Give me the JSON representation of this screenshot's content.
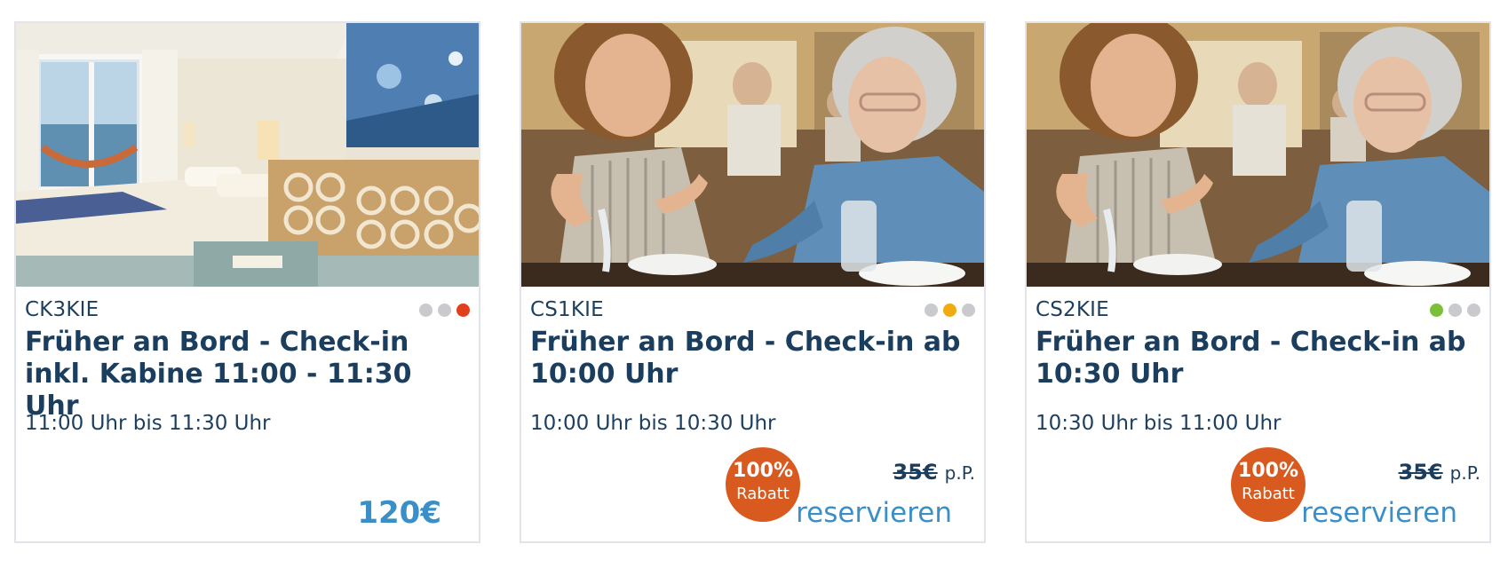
{
  "cards": [
    {
      "photo": "cabin-photo",
      "code": "CK3KIE",
      "status_dots": [
        "#c9cacd",
        "#c9cacd",
        "#e0401c"
      ],
      "title": "Früher an Bord - Check-in inkl. Kabine 11:00 - 11:30 Uhr",
      "time": "11:00 Uhr bis 11:30 Uhr",
      "price": "120€"
    },
    {
      "photo": "restaurant-photo",
      "code": "CS1KIE",
      "status_dots": [
        "#c9cacd",
        "#f0aa12",
        "#c9cacd"
      ],
      "title": "Früher an Bord - Check-in ab 10:00 Uhr",
      "time": "10:00 Uhr bis 10:30 Uhr",
      "badge_percent": "100%",
      "badge_text": "Rabatt",
      "old_price": "35€",
      "per_person": "p.P.",
      "action": "reservieren"
    },
    {
      "photo": "restaurant-photo",
      "code": "CS2KIE",
      "status_dots": [
        "#7bbf3a",
        "#c9cacd",
        "#c9cacd"
      ],
      "title": "Früher an Bord - Check-in ab 10:30 Uhr",
      "time": "10:30 Uhr bis 11:00 Uhr",
      "badge_percent": "100%",
      "badge_text": "Rabatt",
      "old_price": "35€",
      "per_person": "p.P.",
      "action": "reservieren"
    }
  ]
}
